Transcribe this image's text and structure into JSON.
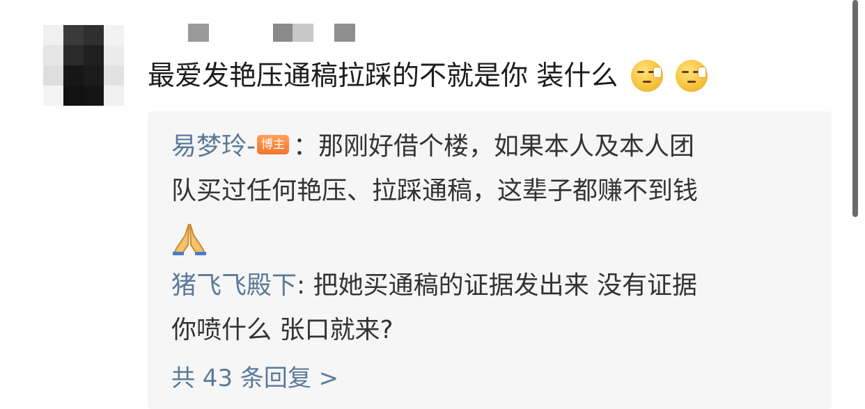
{
  "comment": {
    "text": "最爱发艳压通稿拉踩的不就是你 装什么",
    "emojis": [
      "face-palm-emoji",
      "face-palm-emoji"
    ]
  },
  "replies": {
    "blogger_name": "易梦玲-",
    "blogger_badge": "博主",
    "blogger_text_line1": "：那刚好借个楼，如果本人及本人团",
    "blogger_text_line2": "队买过任何艳压、拉踩通稿，这辈子都赚不到钱",
    "blogger_emoji": "folded-hands-emoji",
    "user2_name": "猪飞飞殿下",
    "user2_text_line1": ": 把她买通稿的证据发出来 没有证据",
    "user2_text_line2": "你喷什么 张口就来?",
    "more_label": "共 43 条回复 >"
  },
  "colors": {
    "username": "#5b7a99",
    "text": "#1d1d1d",
    "reply_bg": "#f6f6f6",
    "badge": "#f2762c"
  }
}
